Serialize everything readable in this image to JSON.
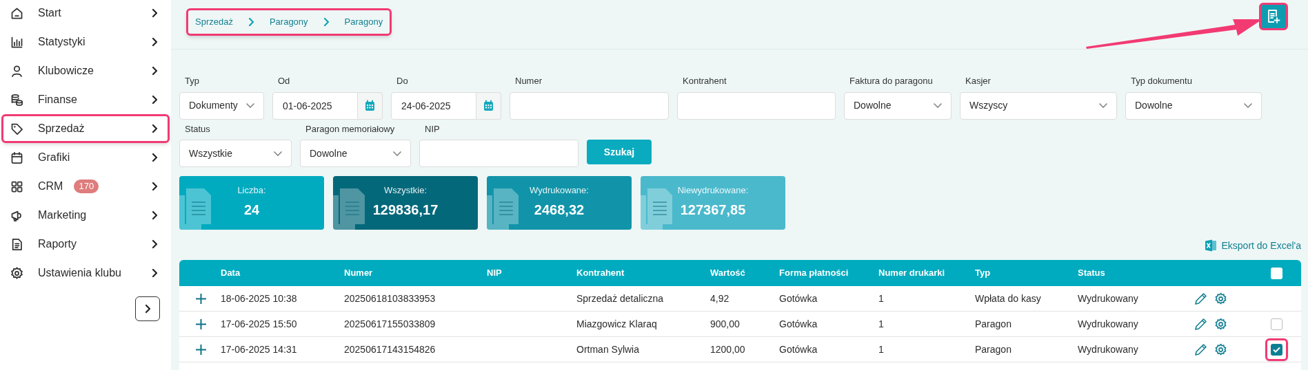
{
  "sidebar": {
    "items": [
      {
        "label": "Start",
        "highlighted": false
      },
      {
        "label": "Statystyki",
        "highlighted": false
      },
      {
        "label": "Klubowicze",
        "highlighted": false
      },
      {
        "label": "Finanse",
        "highlighted": false
      },
      {
        "label": "Sprzedaż",
        "highlighted": true
      },
      {
        "label": "Grafiki",
        "highlighted": false
      },
      {
        "label": "CRM",
        "badge": "170",
        "highlighted": false
      },
      {
        "label": "Marketing",
        "highlighted": false
      },
      {
        "label": "Raporty",
        "highlighted": false
      },
      {
        "label": "Ustawienia klubu",
        "highlighted": false
      }
    ]
  },
  "breadcrumb": {
    "highlighted": true,
    "items": [
      "Sprzedaż",
      "Paragony",
      "Paragony"
    ]
  },
  "new_button": {
    "highlighted": true
  },
  "filters": [
    {
      "label": "Typ",
      "kind": "select",
      "value": "Dokumenty"
    },
    {
      "label": "Od",
      "kind": "date",
      "value": "01-06-2025"
    },
    {
      "label": "Do",
      "kind": "date",
      "value": "24-06-2025"
    },
    {
      "label": "Numer",
      "kind": "text"
    },
    {
      "label": "Kontrahent",
      "kind": "text"
    },
    {
      "label": "Faktura do paragonu",
      "kind": "select",
      "value": "Dowolne"
    },
    {
      "label": "Kasjer",
      "kind": "select",
      "value": "Wszyscy"
    },
    {
      "label": "Typ dokumentu",
      "kind": "select",
      "value": "Dowolne"
    }
  ],
  "filters_row_2": [
    {
      "label": "Status",
      "kind": "select",
      "value": "Wszystkie"
    },
    {
      "label": "Paragon memoriałowy",
      "kind": "select",
      "value": "Dowolne"
    },
    {
      "label": "NIP",
      "kind": "text"
    }
  ],
  "search_button": "Szukaj",
  "cards": [
    {
      "label": "Liczba:",
      "value": "24",
      "color": "#00abc0"
    },
    {
      "label": "Wszystkie:",
      "value": "129836,17",
      "color": "#03687a"
    },
    {
      "label": "Wydrukowane:",
      "value": "2468,32",
      "color": "#1194a9"
    },
    {
      "label": "Niewydrukowane:",
      "value": "127367,85",
      "color": "#4bb9cc"
    }
  ],
  "export_link": "Eksport do Excel'a",
  "table": {
    "columns": [
      "Data",
      "Numer",
      "NIP",
      "Kontrahent",
      "Wartość",
      "Forma płatności",
      "Numer drukarki",
      "Typ",
      "Status"
    ],
    "header_checked": false,
    "rows": [
      {
        "cells": [
          "18-06-2025 10:38",
          "20250618103833953",
          "",
          "Sprzedaż detaliczna",
          "4,92",
          "Gotówka",
          "1",
          "Wpłata do kasy",
          "Wydrukowany"
        ]
      },
      {
        "cells": [
          "17-06-2025 15:50",
          "20250617155033809",
          "",
          "Miazgowicz Klaraq",
          "900,00",
          "Gotówka",
          "1",
          "Paragon",
          "Wydrukowany"
        ],
        "checked": false
      },
      {
        "cells": [
          "17-06-2025 14:31",
          "20250617143154826",
          "",
          "Ortman Sylwia",
          "1200,00",
          "Gotówka",
          "1",
          "Paragon",
          "Wydrukowany"
        ],
        "checked": true,
        "highlighted": true
      }
    ]
  }
}
